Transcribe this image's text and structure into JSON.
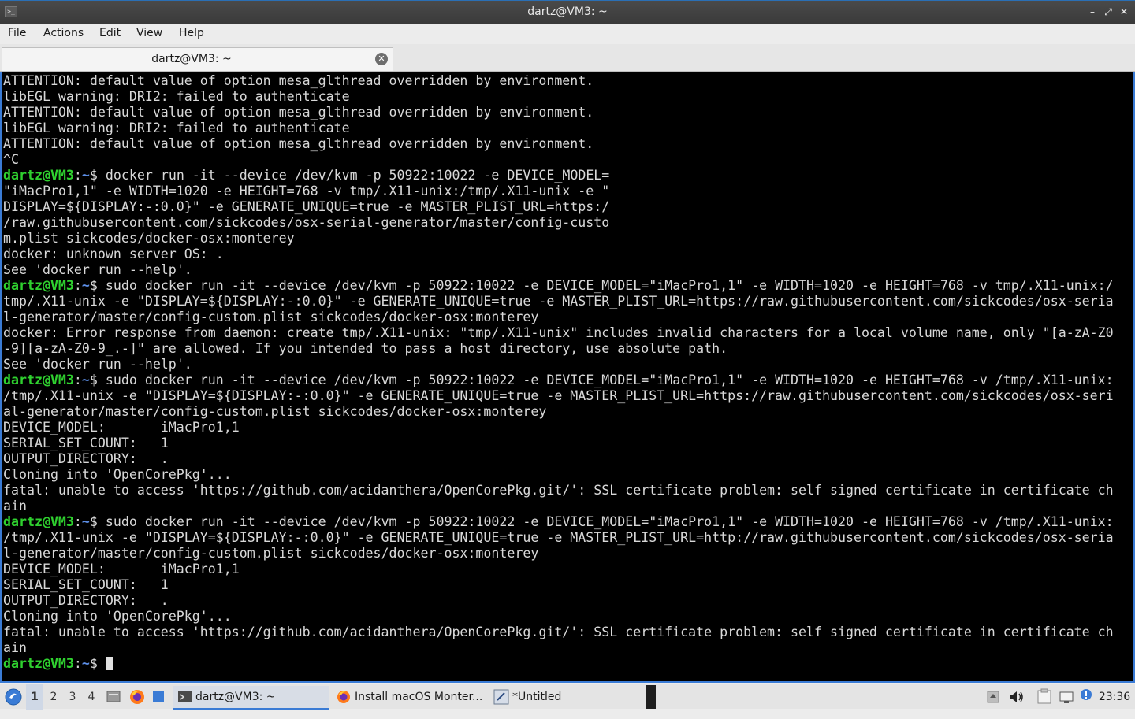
{
  "window": {
    "title": "dartz@VM3: ~",
    "minimize_glyph": "–",
    "maximize_glyph": "⤢",
    "close_glyph": "✕"
  },
  "menu": [
    "File",
    "Actions",
    "Edit",
    "View",
    "Help"
  ],
  "tab": {
    "label": "dartz@VM3: ~",
    "close_glyph": "✕"
  },
  "terminal": {
    "colors": {
      "background": "#000000",
      "text": "#d8d8d8",
      "user": "#2fd12f",
      "path": "#5c8ee6"
    },
    "lines": [
      {
        "text": "ATTENTION: default value of option mesa_glthread overridden by environment."
      },
      {
        "text": "libEGL warning: DRI2: failed to authenticate"
      },
      {
        "text": "ATTENTION: default value of option mesa_glthread overridden by environment."
      },
      {
        "text": "libEGL warning: DRI2: failed to authenticate"
      },
      {
        "text": "ATTENTION: default value of option mesa_glthread overridden by environment."
      },
      {
        "text": "^C"
      },
      {
        "user": "dartz@VM3",
        "sep": ":",
        "path": "~",
        "sym": "$ ",
        "text": "docker run -it --device /dev/kvm -p 50922:10022 -e DEVICE_MODEL="
      },
      {
        "text": "\"iMacPro1,1\" -e WIDTH=1020 -e HEIGHT=768 -v tmp/.X11-unix:/tmp/.X11-unix -e \""
      },
      {
        "text": "DISPLAY=${DISPLAY:-:0.0}\" -e GENERATE_UNIQUE=true -e MASTER_PLIST_URL=https:/"
      },
      {
        "text": "/raw.githubusercontent.com/sickcodes/osx-serial-generator/master/config-custo"
      },
      {
        "text": "m.plist sickcodes/docker-osx:monterey"
      },
      {
        "text": "docker: unknown server OS: ."
      },
      {
        "text": "See 'docker run --help'."
      },
      {
        "user": "dartz@VM3",
        "sep": ":",
        "path": "~",
        "sym": "$ ",
        "text": "sudo docker run -it --device /dev/kvm -p 50922:10022 -e DEVICE_MODEL=\"iMacPro1,1\" -e WIDTH=1020 -e HEIGHT=768 -v tmp/.X11-unix:/"
      },
      {
        "text": "tmp/.X11-unix -e \"DISPLAY=${DISPLAY:-:0.0}\" -e GENERATE_UNIQUE=true -e MASTER_PLIST_URL=https://raw.githubusercontent.com/sickcodes/osx-seria"
      },
      {
        "text": "l-generator/master/config-custom.plist sickcodes/docker-osx:monterey"
      },
      {
        "text": "docker: Error response from daemon: create tmp/.X11-unix: \"tmp/.X11-unix\" includes invalid characters for a local volume name, only \"[a-zA-Z0"
      },
      {
        "text": "-9][a-zA-Z0-9_.-]\" are allowed. If you intended to pass a host directory, use absolute path."
      },
      {
        "text": "See 'docker run --help'."
      },
      {
        "user": "dartz@VM3",
        "sep": ":",
        "path": "~",
        "sym": "$ ",
        "text": "sudo docker run -it --device /dev/kvm -p 50922:10022 -e DEVICE_MODEL=\"iMacPro1,1\" -e WIDTH=1020 -e HEIGHT=768 -v /tmp/.X11-unix:"
      },
      {
        "text": "/tmp/.X11-unix -e \"DISPLAY=${DISPLAY:-:0.0}\" -e GENERATE_UNIQUE=true -e MASTER_PLIST_URL=https://raw.githubusercontent.com/sickcodes/osx-seri"
      },
      {
        "text": "al-generator/master/config-custom.plist sickcodes/docker-osx:monterey"
      },
      {
        "text": "DEVICE_MODEL:       iMacPro1,1"
      },
      {
        "text": "SERIAL_SET_COUNT:   1"
      },
      {
        "text": "OUTPUT_DIRECTORY:   ."
      },
      {
        "text": "Cloning into 'OpenCorePkg'..."
      },
      {
        "text": "fatal: unable to access 'https://github.com/acidanthera/OpenCorePkg.git/': SSL certificate problem: self signed certificate in certificate ch"
      },
      {
        "text": "ain"
      },
      {
        "user": "dartz@VM3",
        "sep": ":",
        "path": "~",
        "sym": "$ ",
        "text": "sudo docker run -it --device /dev/kvm -p 50922:10022 -e DEVICE_MODEL=\"iMacPro1,1\" -e WIDTH=1020 -e HEIGHT=768 -v /tmp/.X11-unix:"
      },
      {
        "text": "/tmp/.X11-unix -e \"DISPLAY=${DISPLAY:-:0.0}\" -e GENERATE_UNIQUE=true -e MASTER_PLIST_URL=http://raw.githubusercontent.com/sickcodes/osx-seria"
      },
      {
        "text": "l-generator/master/config-custom.plist sickcodes/docker-osx:monterey"
      },
      {
        "text": "DEVICE_MODEL:       iMacPro1,1"
      },
      {
        "text": "SERIAL_SET_COUNT:   1"
      },
      {
        "text": "OUTPUT_DIRECTORY:   ."
      },
      {
        "text": "Cloning into 'OpenCorePkg'..."
      },
      {
        "text": "fatal: unable to access 'https://github.com/acidanthera/OpenCorePkg.git/': SSL certificate problem: self signed certificate in certificate ch"
      },
      {
        "text": "ain"
      },
      {
        "user": "dartz@VM3",
        "sep": ":",
        "path": "~",
        "sym": "$ ",
        "text": "",
        "cursor": true
      }
    ]
  },
  "taskbar": {
    "workspaces": [
      "1",
      "2",
      "3",
      "4"
    ],
    "active_workspace": "1",
    "tasks": [
      {
        "label": "dartz@VM3: ~",
        "icon": "terminal-icon",
        "active": true
      },
      {
        "label": "Install macOS Monter...",
        "icon": "firefox-icon",
        "active": false
      },
      {
        "label": "*Untitled",
        "icon": "text-editor-icon",
        "active": false
      }
    ],
    "clock": "23:36"
  }
}
